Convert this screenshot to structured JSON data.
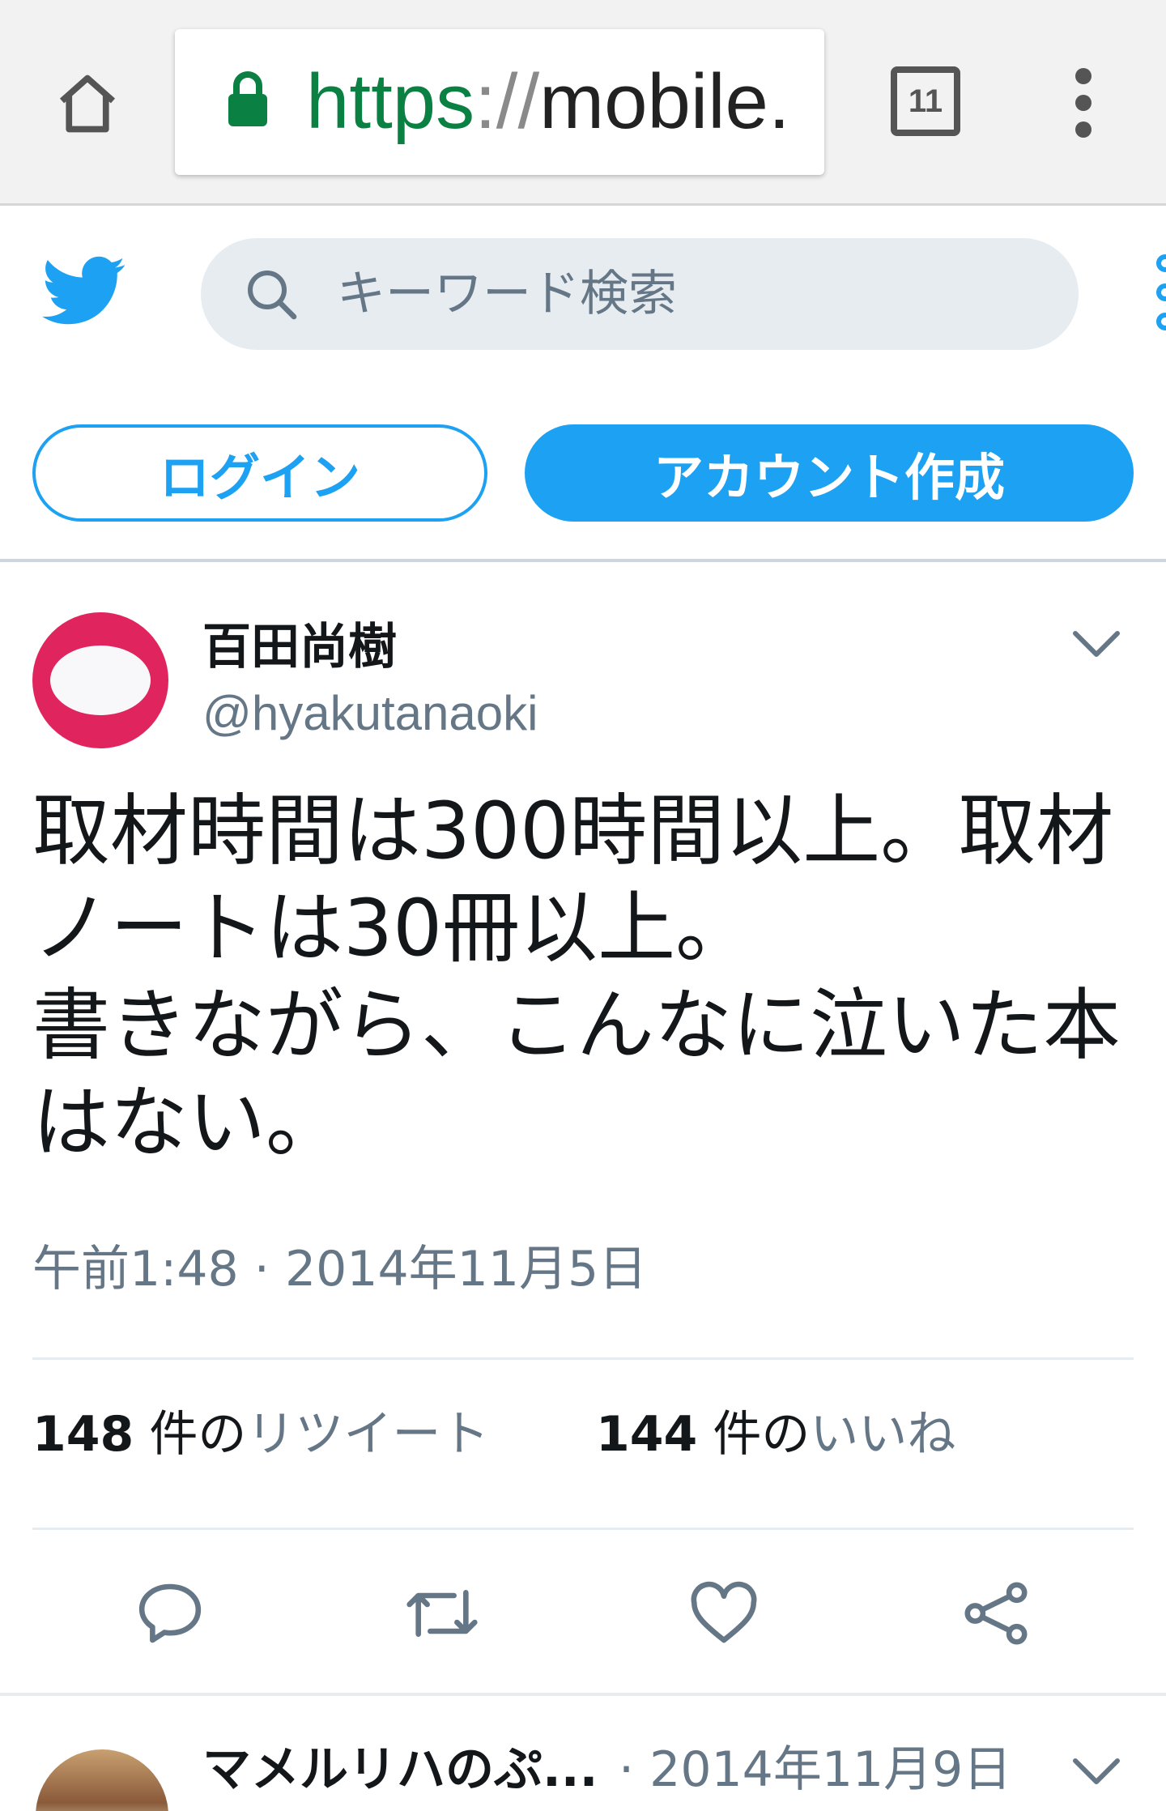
{
  "browser": {
    "url_scheme": "https",
    "url_sep": "://",
    "url_host": "mobile.",
    "tab_count": "11"
  },
  "header": {
    "search_placeholder": "キーワード検索",
    "login_label": "ログイン",
    "signup_label": "アカウント作成"
  },
  "tweet": {
    "user_name": "百田尚樹",
    "user_handle": "@hyakutanaoki",
    "text": "取材時間は300時間以上。取材\nノートは30冊以上。\n書きながら、こんなに泣いた本\nはない。",
    "timestamp": "午前1:48 · 2014年11月5日",
    "retweet_count": "148",
    "retweet_unit": " 件の",
    "retweet_label": "リツイート",
    "like_count": "144",
    "like_unit": " 件の",
    "like_label": "いいね"
  },
  "next_tweet": {
    "user_name": "マメルリハのぷ...",
    "date": " · 2014年11月9日"
  },
  "colors": {
    "twitter_blue": "#1da1f2",
    "secure_green": "#0b8043",
    "avatar_red": "#e0245e",
    "secondary_text": "#657786"
  },
  "icons": [
    "home-icon",
    "lock-icon",
    "tab-switcher-icon",
    "overflow-menu-icon",
    "twitter-bird-icon",
    "search-icon",
    "chevron-down-icon",
    "reply-icon",
    "retweet-icon",
    "like-heart-icon",
    "share-icon"
  ]
}
